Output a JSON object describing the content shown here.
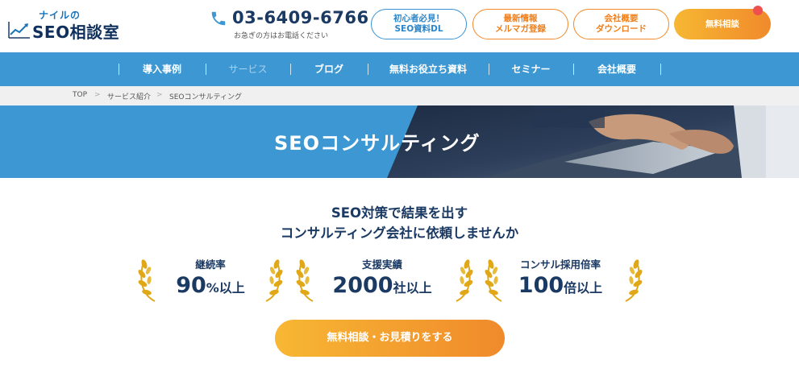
{
  "header": {
    "logo_small": "ナイルの",
    "logo_main": "SEO相談室",
    "phone_number": "03-6409-6766",
    "phone_note": "お急ぎの方はお電話ください",
    "buttons": {
      "beginner_line1": "初心者必見！",
      "beginner_line2": "SEO資料DL",
      "news_line1": "最新情報",
      "news_line2": "メルマガ登録",
      "company_line1": "会社概要",
      "company_line2": "ダウンロード",
      "free": "無料相談"
    }
  },
  "nav": {
    "items": [
      {
        "label": "導入事例"
      },
      {
        "label": "サービス"
      },
      {
        "label": "ブログ"
      },
      {
        "label": "無料お役立ち資料"
      },
      {
        "label": "セミナー"
      },
      {
        "label": "会社概要"
      }
    ]
  },
  "breadcrumb": {
    "items": [
      "TOP",
      "サービス紹介",
      "SEOコンサルティング"
    ],
    "separator": ">"
  },
  "hero": {
    "title": "SEOコンサルティング"
  },
  "lead": {
    "line1": "SEO対策で結果を出す",
    "line2": "コンサルティング会社に依頼しませんか"
  },
  "stats": [
    {
      "label": "継続率",
      "number": "90",
      "unit": "%以上"
    },
    {
      "label": "支援実績",
      "number": "2000",
      "unit": "社以上"
    },
    {
      "label": "コンサル採用倍率",
      "number": "100",
      "unit": "倍以上"
    }
  ],
  "cta": {
    "label": "無料相談・お見積りをする"
  },
  "colors": {
    "brand_blue": "#3c97d3",
    "navy": "#1b3a63",
    "orange": "#f08a2b",
    "gold": "#e0a817"
  }
}
